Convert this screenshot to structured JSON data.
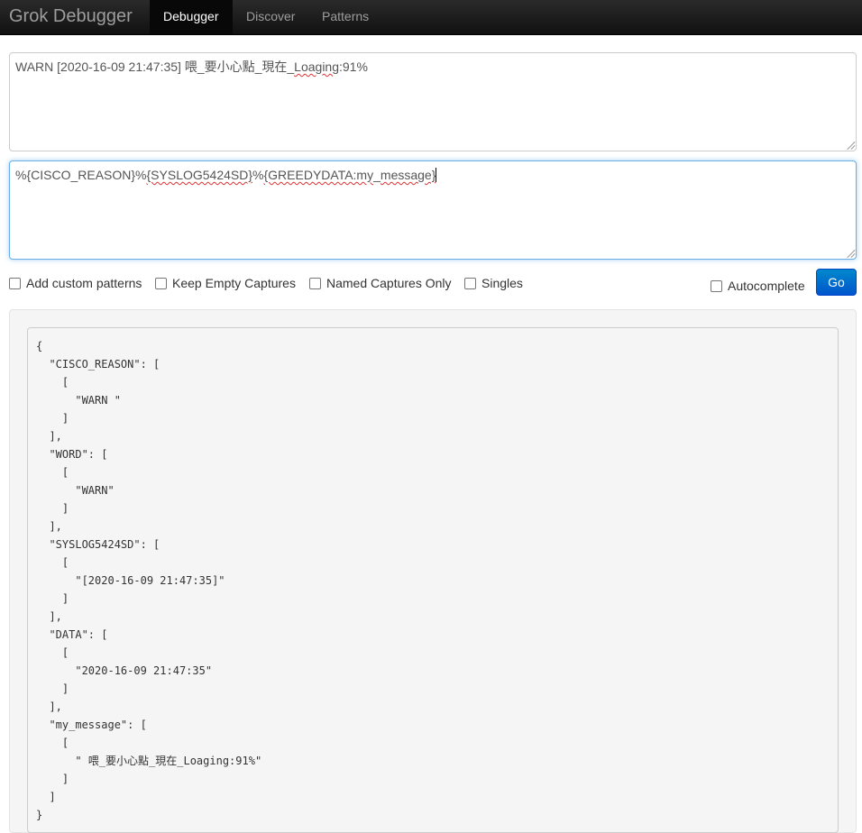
{
  "navbar": {
    "brand": "Grok Debugger",
    "items": [
      {
        "label": "Debugger",
        "active": true
      },
      {
        "label": "Discover",
        "active": false
      },
      {
        "label": "Patterns",
        "active": false
      }
    ]
  },
  "input": {
    "prefix": "WARN [2020-16-09 21:47:35] 喂_要小心點_現在_",
    "misspelled": "Loaging",
    "suffix": ":91%"
  },
  "pattern": {
    "part1": "%{CISCO_REASON}%",
    "part2": "{SYSLOG5424SD}",
    "part3": "%",
    "part4": "{GREEDYDATA:my",
    "part5": "_",
    "part6": "message}"
  },
  "options": {
    "add_custom_patterns": "Add custom patterns",
    "keep_empty_captures": "Keep Empty Captures",
    "named_captures_only": "Named Captures Only",
    "singles": "Singles",
    "autocomplete": "Autocomplete"
  },
  "go_label": "Go",
  "result": "{\n  \"CISCO_REASON\": [\n    [\n      \"WARN \"\n    ]\n  ],\n  \"WORD\": [\n    [\n      \"WARN\"\n    ]\n  ],\n  \"SYSLOG5424SD\": [\n    [\n      \"[2020-16-09 21:47:35]\"\n    ]\n  ],\n  \"DATA\": [\n    [\n      \"2020-16-09 21:47:35\"\n    ]\n  ],\n  \"my_message\": [\n    [\n      \" 喂_要小心點_現在_Loaging:91%\"\n    ]\n  ]\n}",
  "colors": {
    "navbar_bg": "#1b1b1b",
    "accent": "#0070cc",
    "focus_border": "#66afe9"
  }
}
